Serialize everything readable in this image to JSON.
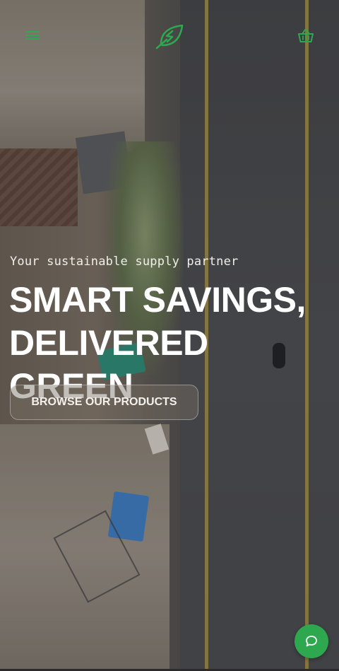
{
  "header": {
    "menu_icon": "hamburger-menu-icon",
    "logo_icon": "leaf-logo-icon",
    "cart_icon": "basket-icon"
  },
  "hero": {
    "tagline": "Your sustainable supply partner",
    "headline_line1": "SMART SAVINGS,",
    "headline_line2": "DELIVERED GREEN",
    "cta_label": "BROWSE OUR PRODUCTS"
  },
  "chat": {
    "icon": "chat-bubble-icon"
  },
  "colors": {
    "accent": "#2ea84f",
    "headline": "#ffffff"
  }
}
